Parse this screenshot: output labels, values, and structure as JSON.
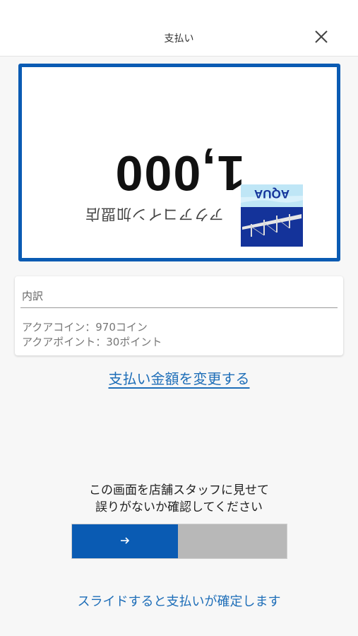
{
  "header": {
    "title": "支払い",
    "close_icon": "close-icon"
  },
  "payment": {
    "amount": "1,000",
    "shop_name": "アクアコイン加盟店",
    "shop_logo_text": "AQUA",
    "display_orientation": "rotated 180° (upside down, facing store staff)"
  },
  "breakdown": {
    "title": "内訳",
    "coin_line": "アクアコイン：970コイン",
    "point_line": "アクアポイント：30ポイント"
  },
  "actions": {
    "change_amount_label": "支払い金額を変更する"
  },
  "instruction": {
    "line1": "この画面を店舗スタッフに見せて",
    "line2": "誤りがないか確認してください"
  },
  "slider": {
    "arrow_icon": "arrow-right-icon",
    "hint": "スライドすると支払いが確定します"
  },
  "colors": {
    "accent": "#0a5bb3",
    "link": "#1e6eb8",
    "slider_track": "#b8b8b8"
  }
}
